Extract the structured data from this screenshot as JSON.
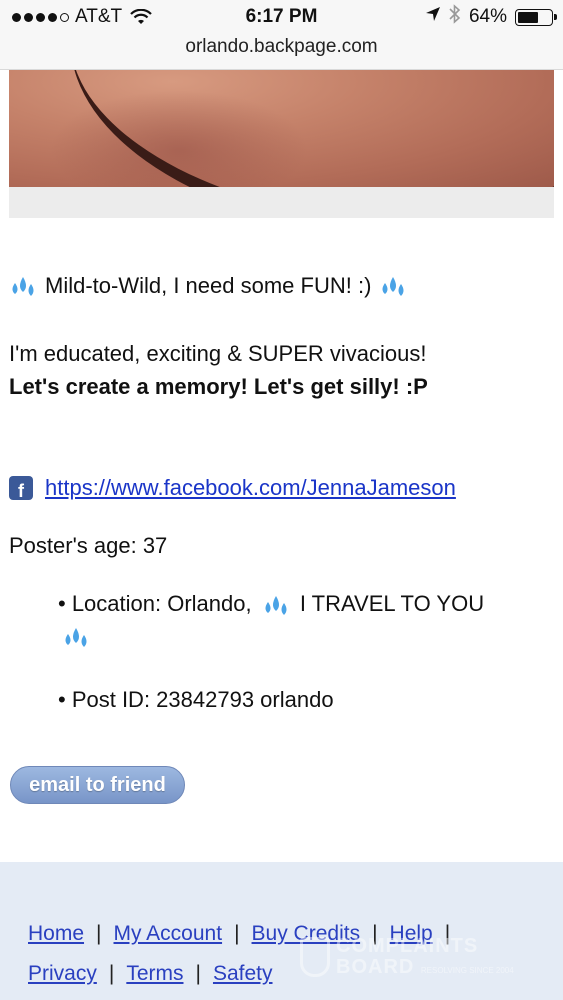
{
  "status_bar": {
    "carrier": "AT&T",
    "time": "6:17 PM",
    "battery": "64%",
    "battery_level": 0.64,
    "signal_bars": 4
  },
  "browser": {
    "url": "orlando.backpage.com"
  },
  "post": {
    "headline": "Mild-to-Wild, I need some FUN! :)",
    "line1": "I'm educated, exciting & SUPER vivacious!",
    "line2": "Let's create a memory! Let's get silly! :P",
    "facebook_url": "https://www.facebook.com/JennaJameson",
    "poster_age": "Poster's age: 37",
    "location": "• Location: Orlando,",
    "location_extra": "I TRAVEL TO YOU",
    "post_id": "• Post ID: 23842793 orlando",
    "email_button": "email to friend"
  },
  "footer": {
    "links": [
      "Home",
      "My Account",
      "Buy Credits",
      "Help",
      "Privacy",
      "Terms",
      "Safety"
    ],
    "watermark_line1": "COMPLAINTS",
    "watermark_line2": "BOARD",
    "watermark_tag": "RESOLVING SINCE 2004"
  },
  "icons": [
    "wifi-icon",
    "location-arrow-icon",
    "bluetooth-icon",
    "battery-icon",
    "sweat-droplets-icon",
    "facebook-icon"
  ],
  "colors": {
    "link": "#1a35c8",
    "footer_bg": "#e4ebf5",
    "button": "#8aa6d6",
    "facebook": "#3b5998"
  }
}
